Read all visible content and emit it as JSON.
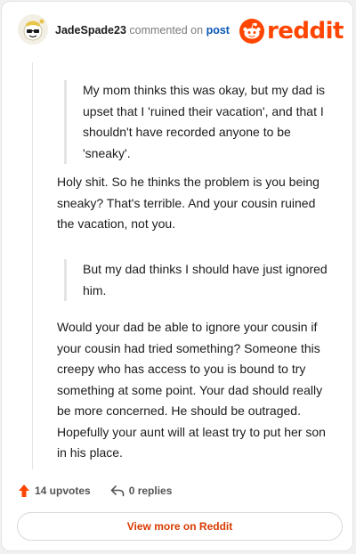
{
  "header": {
    "username": "JadeSpade23",
    "action_text": "commented on",
    "post_link": "post",
    "logo_text": "reddit"
  },
  "comment": {
    "quote1": "My mom thinks this was okay, but my dad is upset that I 'ruined their vacation', and that I shouldn't have recorded anyone to be 'sneaky'.",
    "para1": "Holy shit. So he thinks the problem is you being sneaky? That's terrible. And your cousin ruined the vacation, not you.",
    "quote2": "But my dad thinks I should have just ignored him.",
    "para2": "Would your dad be able to ignore your cousin if your cousin had tried something? Someone this creepy who has access to you is bound to try something at some point. Your dad should really be more concerned. He should be outraged. Hopefully your aunt will at least try to put her son in his place."
  },
  "footer": {
    "upvotes": "14 upvotes",
    "replies": "0 replies",
    "view_more": "View more on Reddit"
  },
  "colors": {
    "brand": "#ff4500",
    "link": "#0b57b4",
    "view_more_text": "#d93a00"
  },
  "icons": {
    "avatar": "snoo-avatar-with-sunglasses",
    "upvote": "upvote-arrow-icon",
    "reply": "reply-arrow-icon",
    "logo": "reddit-snoo-icon"
  }
}
